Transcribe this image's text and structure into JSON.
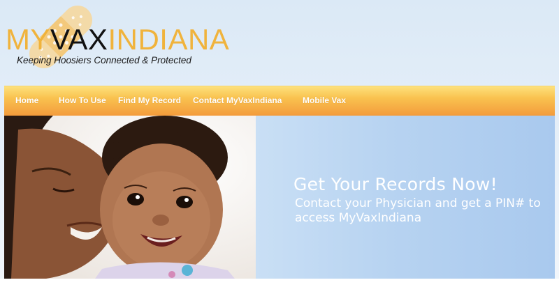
{
  "brand": {
    "my": "MY",
    "vax": "VAX",
    "indiana": "INDIANA",
    "tagline": "Keeping Hoosiers Connected & Protected",
    "logo_icon": "bandage-icon",
    "colors": {
      "gold": "#f0b33c",
      "dark": "#111111"
    }
  },
  "nav": {
    "items": [
      {
        "label": "Home"
      },
      {
        "label": "How To Use"
      },
      {
        "label": "Find My Record"
      },
      {
        "label": "Contact MyVaxIndiana"
      },
      {
        "label": "Mobile Vax"
      }
    ],
    "colors": {
      "top": "#fde17c",
      "bottom": "#f39b3c",
      "text": "#ffffff"
    }
  },
  "hero": {
    "headline": "Get Your Records Now!",
    "subtext": "Contact your Physician and get a PIN# to access MyVaxIndiana",
    "panel_color": "#b7d3f1"
  }
}
